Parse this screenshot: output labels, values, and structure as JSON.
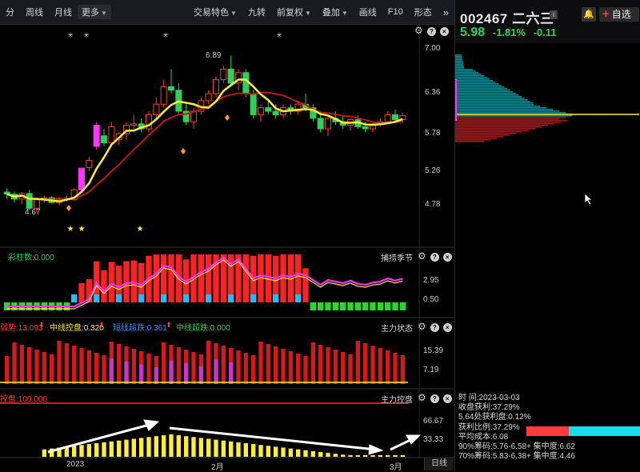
{
  "toolbar": {
    "items": [
      {
        "label": "分"
      },
      {
        "label": "周线"
      },
      {
        "label": "月线"
      },
      {
        "label": "更多"
      },
      {
        "label": "交易特色"
      },
      {
        "label": "九转"
      },
      {
        "label": "前复权"
      },
      {
        "label": "叠加"
      },
      {
        "label": "画线"
      },
      {
        "label": "F10"
      },
      {
        "label": "形态"
      }
    ],
    "expand_icon": "double-chevron-right-icon"
  },
  "quote": {
    "code_name": "002467 二六三",
    "info": "i",
    "watch_label": "自选",
    "price": "5.98",
    "change_pct": "-1.81%",
    "change": "-0.11",
    "up_color": "#ff3b3b",
    "down_color": "#2fd05a"
  },
  "main_chart": {
    "y_ticks": [
      "7.00",
      "6.36",
      "5.78",
      "5.26",
      "4.78"
    ],
    "high_label": "6.89",
    "low_label": "4.67",
    "ma_colors": [
      "#ffee33",
      "#c01818"
    ]
  },
  "panel1": {
    "label": "彩柱数:0.000",
    "title": "捕捞季节",
    "y_ticks": [
      "2.95",
      "0.50"
    ]
  },
  "panel2": {
    "labels": [
      {
        "text": "弱势:13.093",
        "color": "#ff3b3b"
      },
      {
        "text": "中线控盘:0.320",
        "color": "#ffee33"
      },
      {
        "text": "短线超跌:0.361",
        "color": "#3b8cff"
      },
      {
        "text": "中线超跌:0.000",
        "color": "#2fd05a"
      }
    ],
    "title": "主力状态",
    "y_ticks": [
      "15.39",
      "7.19"
    ]
  },
  "panel3": {
    "label": "控盘:100.000",
    "title": "主力控盘",
    "y_ticks": [
      "66.67",
      "33.33"
    ]
  },
  "x_axis": {
    "labels": [
      "2023",
      "2月",
      "3月"
    ],
    "period_button": "日线"
  },
  "stats": {
    "time": "时      间:2023-03-03",
    "profit": "收盘获利:37.29%",
    "profit_at": "5.64处获利盘:0.12%",
    "ratio": "获利比例:37.29%",
    "avg_cost": "平均成本:6.08",
    "c90": "90%筹码:5.76-6.58+ 集中度:6.62",
    "c70": "70%筹码:5.83-6.38+ 集中度:4.46",
    "ratio_value": 0.3729
  }
}
